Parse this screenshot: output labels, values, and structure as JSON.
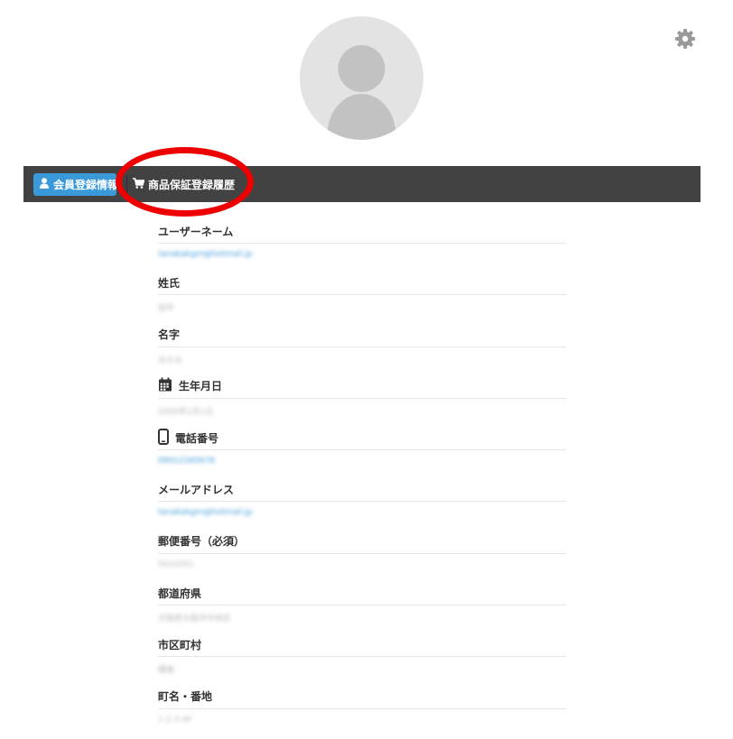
{
  "settings": {
    "icon": "gear-icon"
  },
  "profile": {
    "avatar_icon": "user-avatar-placeholder"
  },
  "tabs": {
    "member": {
      "label": "会員登録情報",
      "icon": "user-icon"
    },
    "history": {
      "label": "商品保証登録履歴",
      "icon": "cart-icon"
    }
  },
  "fields": [
    {
      "label": "ユーザーネーム",
      "value": "tanakakgm@hotmail.jp",
      "link": true,
      "icon": ""
    },
    {
      "label": "姓氏",
      "value": "田中",
      "link": false,
      "icon": ""
    },
    {
      "label": "名字",
      "value": "ゆきみ",
      "link": false,
      "icon": ""
    },
    {
      "label": "生年月日",
      "value": "2000年1月1日",
      "link": false,
      "icon": "calendar-icon"
    },
    {
      "label": "電話番号",
      "value": "09012345678",
      "link": true,
      "icon": "phone-icon"
    },
    {
      "label": "メールアドレス",
      "value": "tanakakgm@hotmail.jp",
      "link": true,
      "icon": ""
    },
    {
      "label": "郵便番号（必須）",
      "value": "5410051",
      "link": false,
      "icon": ""
    },
    {
      "label": "都道府県",
      "value": "大阪府大阪市中央区",
      "link": false,
      "icon": ""
    },
    {
      "label": "市区町村",
      "value": "備後",
      "link": false,
      "icon": ""
    },
    {
      "label": "町名・番地",
      "value": "1-2-3-4F",
      "link": false,
      "icon": ""
    }
  ],
  "colors": {
    "accent": "#3a9ad9",
    "tabbar": "#424242",
    "annotation": "#ee0000"
  }
}
